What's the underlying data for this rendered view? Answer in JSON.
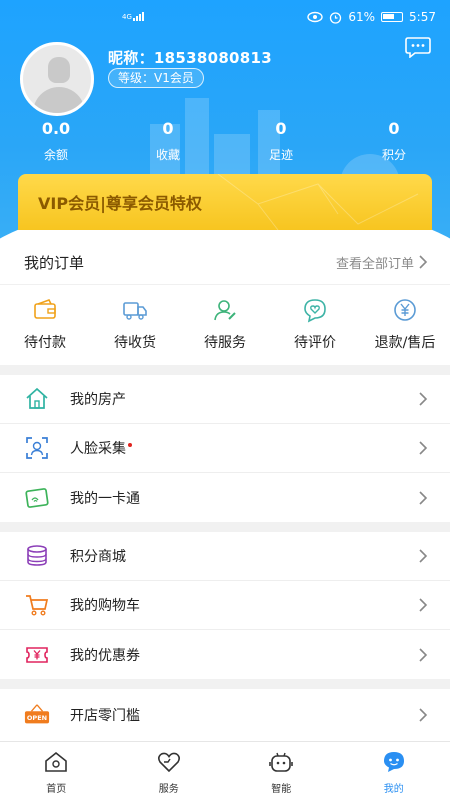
{
  "status_bar": {
    "network": "4G",
    "battery": "61%",
    "time": "5:57"
  },
  "profile": {
    "nickname": "昵称：18538080813",
    "level": "等级：V1会员"
  },
  "stats": [
    {
      "value": "0.0",
      "label": "余额"
    },
    {
      "value": "0",
      "label": "收藏"
    },
    {
      "value": "0",
      "label": "足迹"
    },
    {
      "value": "0",
      "label": "积分"
    }
  ],
  "vip_banner": {
    "text": "VIP会员|尊享会员特权"
  },
  "orders": {
    "title": "我的订单",
    "view_all": "查看全部订单",
    "items": [
      {
        "label": "待付款",
        "icon": "wallet-icon"
      },
      {
        "label": "待收货",
        "icon": "truck-icon"
      },
      {
        "label": "待服务",
        "icon": "service-person-icon"
      },
      {
        "label": "待评价",
        "icon": "heart-chat-icon"
      },
      {
        "label": "退款/售后",
        "icon": "yen-circle-icon"
      }
    ]
  },
  "menu_group_1": [
    {
      "label": "我的房产",
      "icon": "house-icon"
    },
    {
      "label": "人脸采集",
      "icon": "face-scan-icon",
      "dot": true
    },
    {
      "label": "我的一卡通",
      "icon": "card-icon"
    }
  ],
  "menu_group_2": [
    {
      "label": "积分商城",
      "icon": "coins-icon"
    },
    {
      "label": "我的购物车",
      "icon": "cart-icon"
    },
    {
      "label": "我的优惠券",
      "icon": "coupon-icon"
    }
  ],
  "menu_group_3": [
    {
      "label": "开店零门槛",
      "icon": "open-sign-icon"
    }
  ],
  "open_sign_text": "OPEN",
  "tabbar": [
    {
      "label": "首页",
      "icon": "home-tab-icon"
    },
    {
      "label": "服务",
      "icon": "heart-tab-icon"
    },
    {
      "label": "智能",
      "icon": "robot-tab-icon"
    },
    {
      "label": "我的",
      "icon": "me-tab-icon",
      "active": true
    }
  ],
  "colors": {
    "primary": "#2a8ff2",
    "header": "#1ea3ff",
    "vip": "#f7c520",
    "vip_text": "#8b5a00"
  }
}
